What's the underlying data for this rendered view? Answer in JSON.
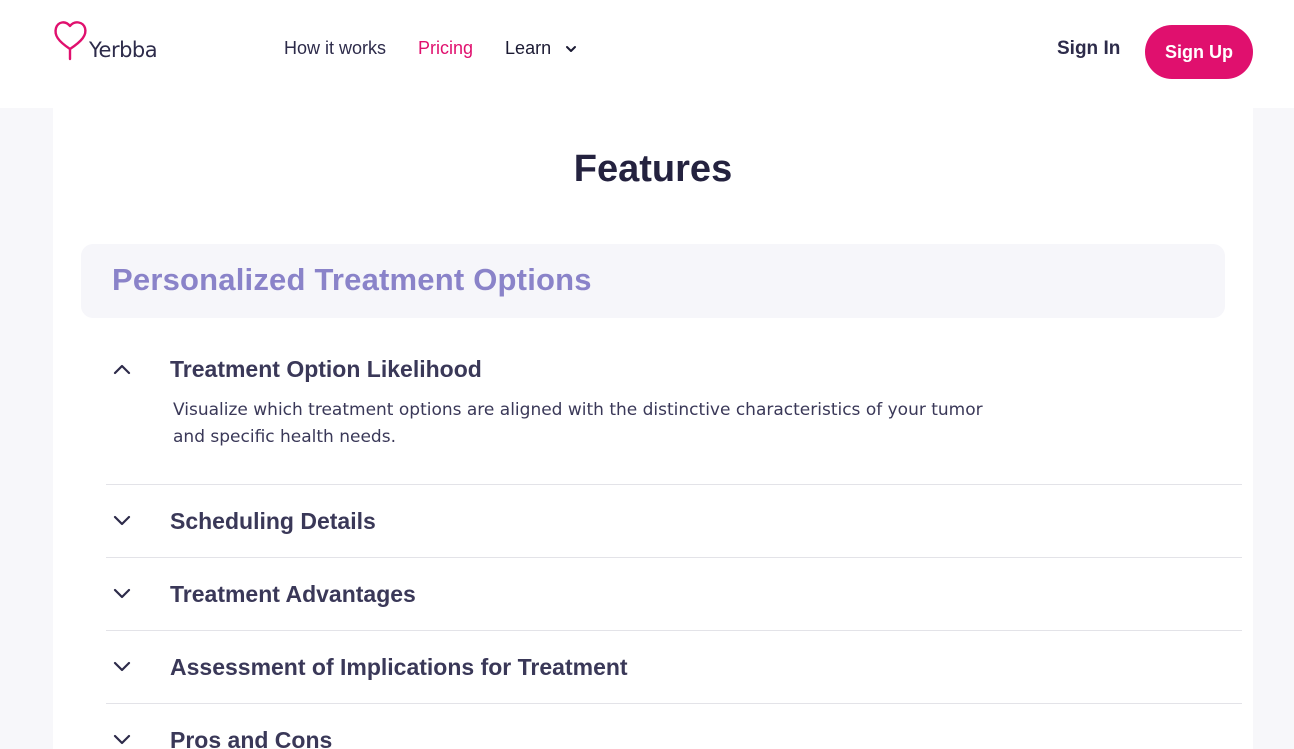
{
  "header": {
    "logo_text": "Yerbba",
    "nav": {
      "how_it_works": "How it works",
      "pricing": "Pricing",
      "learn": "Learn"
    },
    "sign_in": "Sign In",
    "sign_up": "Sign Up"
  },
  "main": {
    "title": "Features",
    "section": {
      "title": "Personalized Treatment Options",
      "items": [
        {
          "title": "Treatment Option Likelihood",
          "expanded": true,
          "body": "Visualize which treatment options are aligned with the distinctive characteristics of your tumor and specific health needs."
        },
        {
          "title": "Scheduling Details",
          "expanded": false
        },
        {
          "title": "Treatment Advantages",
          "expanded": false
        },
        {
          "title": "Assessment of Implications for Treatment",
          "expanded": false
        },
        {
          "title": "Pros and Cons",
          "expanded": false
        }
      ]
    }
  },
  "colors": {
    "brand": "#e0106e",
    "section_title": "#8a83c9",
    "text": "#2d2b4a",
    "page_bg": "#f7f7fa"
  },
  "icons": [
    "heart-logo-icon",
    "chevron-down-icon",
    "chevron-up-icon"
  ]
}
